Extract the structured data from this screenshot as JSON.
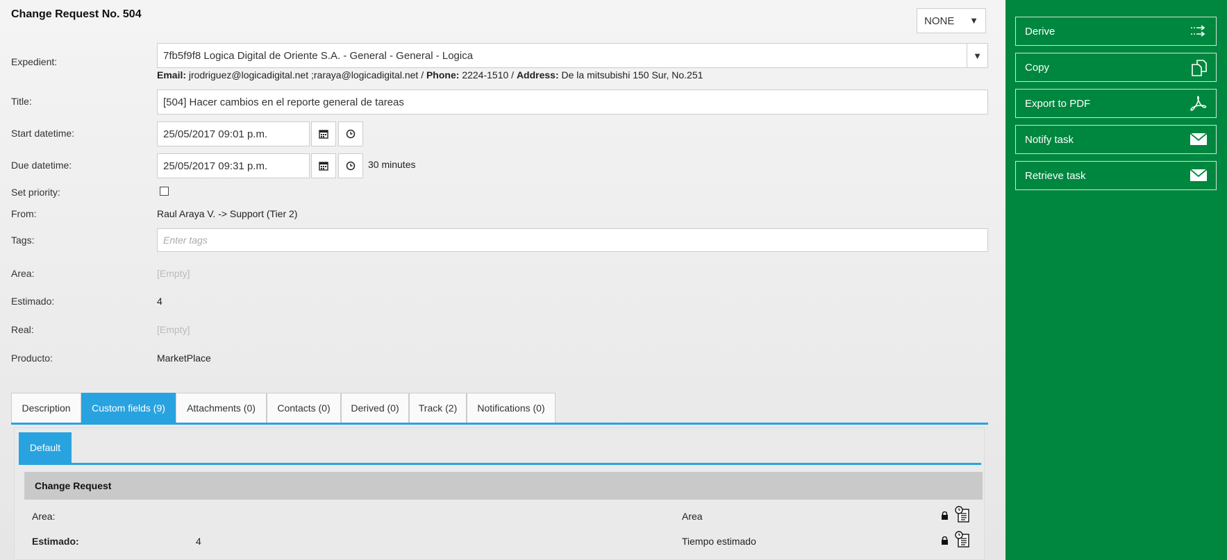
{
  "header": {
    "title": "Change Request  No.  504",
    "status_select": "NONE"
  },
  "form": {
    "expedient": {
      "label": "Expedient:",
      "value": "7fb5f9f8 Logica Digital de Oriente S.A. - General - General - Logica",
      "email_label": "Email:",
      "email_value": "jrodriguez@logicadigital.net ;raraya@logicadigital.net",
      "sep1": "/",
      "phone_label": "Phone:",
      "phone_value": "2224-1510",
      "sep2": "/",
      "address_label": "Address:",
      "address_value": "De la mitsubishi 150 Sur, No.251"
    },
    "title": {
      "label": "Title:",
      "value": "[504] Hacer cambios en el reporte general de tareas"
    },
    "start": {
      "label": "Start datetime:",
      "value": "25/05/2017 09:01 p.m."
    },
    "due": {
      "label": "Due datetime:",
      "value": "25/05/2017 09:31 p.m.",
      "duration": "30 minutes"
    },
    "priority": {
      "label": "Set priority:",
      "checked": false
    },
    "from": {
      "label": "From:",
      "value": "Raul Araya V. -> Support (Tier 2)"
    },
    "tags": {
      "label": "Tags:",
      "placeholder": "Enter tags"
    },
    "area": {
      "label": "Area:",
      "value": "[Empty]"
    },
    "estimado": {
      "label": "Estimado:",
      "value": "4"
    },
    "real": {
      "label": "Real:",
      "value": "[Empty]"
    },
    "producto": {
      "label": "Producto:",
      "value": "MarketPlace"
    }
  },
  "tabs": [
    {
      "label": "Description",
      "active": false
    },
    {
      "label": "Custom fields (9)",
      "active": true
    },
    {
      "label": "Attachments (0)",
      "active": false
    },
    {
      "label": "Contacts (0)",
      "active": false
    },
    {
      "label": "Derived (0)",
      "active": false
    },
    {
      "label": "Track (2)",
      "active": false
    },
    {
      "label": "Notifications (0)",
      "active": false
    }
  ],
  "custom_fields": {
    "subtab": "Default",
    "section_title": "Change Request",
    "rows": [
      {
        "label": "Area:",
        "value": "",
        "description": "Area",
        "bold": false
      },
      {
        "label": "Estimado:",
        "value": "4",
        "description": "Tiempo estimado",
        "bold": true
      }
    ]
  },
  "sidebar": {
    "buttons": [
      {
        "label": "Derive",
        "icon": "derive-arrows-icon"
      },
      {
        "label": "Copy",
        "icon": "copy-icon"
      },
      {
        "label": "Export to PDF",
        "icon": "pdf-icon"
      },
      {
        "label": "Notify task",
        "icon": "envelope-icon"
      },
      {
        "label": "Retrieve task",
        "icon": "envelope-icon"
      }
    ]
  },
  "colors": {
    "sidebar": "#00873f",
    "accent": "#29a3df"
  }
}
